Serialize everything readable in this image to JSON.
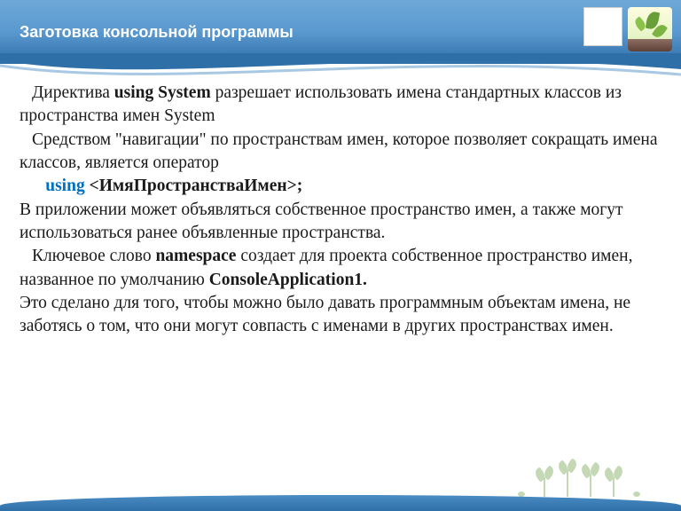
{
  "header": {
    "title": "Заготовка консольной программы"
  },
  "body": {
    "p1_before": "Директива ",
    "p1_bold": "using System",
    "p1_after": " разрешает использовать имена стандартных классов из пространства имен System",
    "p2": "Средством \"навигации\" по пространствам имен, которое позволяет сокращать имена классов, является  оператор",
    "p3_indent": "      ",
    "p3_kw": "using",
    "p3_after": " <ИмяПространстваИмен>;",
    "p4": "В приложении может объявляться собственное пространство имен, а также могут использоваться ранее объявленные пространства.",
    "p5_before": "Ключевое слово ",
    "p5_bold": "namespace",
    "p5_after": " создает для проекта собственное пространство имен, названное по умолчанию ",
    "p5_bold2": "ConsoleApplication1.",
    "p6": "Это сделано для того, чтобы можно было давать программным объектам имена, не заботясь о том, что они могут совпасть с именами в других пространствах имен."
  }
}
